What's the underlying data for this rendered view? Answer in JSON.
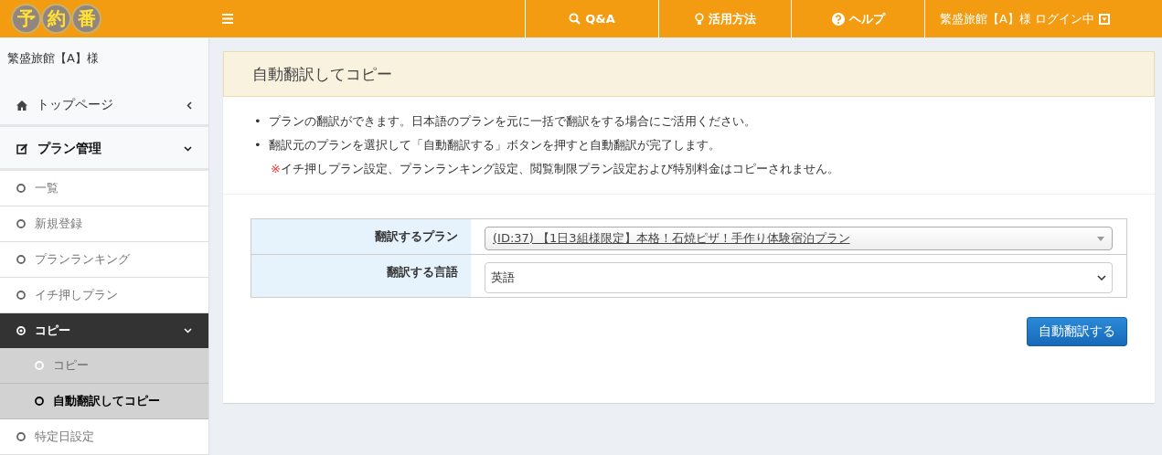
{
  "header": {
    "logo": [
      "予",
      "約",
      "番"
    ],
    "nav": [
      {
        "kind": "search",
        "label": "Q&A"
      },
      {
        "kind": "bulb",
        "label": "活用方法"
      },
      {
        "kind": "help",
        "label": "ヘルプ"
      },
      {
        "kind": "user",
        "label": "繁盛旅館【A】様 ログイン中"
      }
    ]
  },
  "sidebar": {
    "user": "繁盛旅館【A】様",
    "items": [
      {
        "kind": "section",
        "label": "トップページ",
        "expanded": false
      },
      {
        "kind": "section",
        "label": "プラン管理",
        "expanded": true
      },
      {
        "kind": "link",
        "label": "一覧",
        "selected": false
      },
      {
        "kind": "link",
        "label": "新規登録",
        "selected": false
      },
      {
        "kind": "link",
        "label": "プランランキング",
        "selected": false
      },
      {
        "kind": "link",
        "label": "イチ押しプラン",
        "selected": false
      },
      {
        "kind": "group",
        "label": "コピー",
        "expanded": true,
        "children": [
          {
            "label": "コピー",
            "selected": false
          },
          {
            "label": "自動翻訳してコピー",
            "selected": true
          }
        ]
      },
      {
        "kind": "link",
        "label": "特定日設定",
        "selected": false
      }
    ]
  },
  "panel": {
    "title": "自動翻訳してコピー",
    "notes": [
      {
        "kind": "bullet",
        "mark": "•",
        "text": "プランの翻訳ができます。日本語のプランを元に一括で翻訳をする場合にご活用ください。"
      },
      {
        "kind": "bullet",
        "mark": "•",
        "text": "翻訳元のプランを選択して「自動翻訳する」ボタンを押すと自動翻訳が完了します。"
      },
      {
        "kind": "warning",
        "mark": "※",
        "text": "イチ押しプラン設定、プランランキング設定、閲覧制限プラン設定および特別料金はコピーされません。"
      }
    ],
    "form": [
      {
        "kind": "combo",
        "label": "翻訳するプラン",
        "value": "(ID:37) 【1日3組様限定】本格！石焼ピザ！手作り体験宿泊プラン"
      },
      {
        "kind": "select",
        "label": "翻訳する言語",
        "value": "英語"
      }
    ],
    "button": "自動翻訳する"
  }
}
